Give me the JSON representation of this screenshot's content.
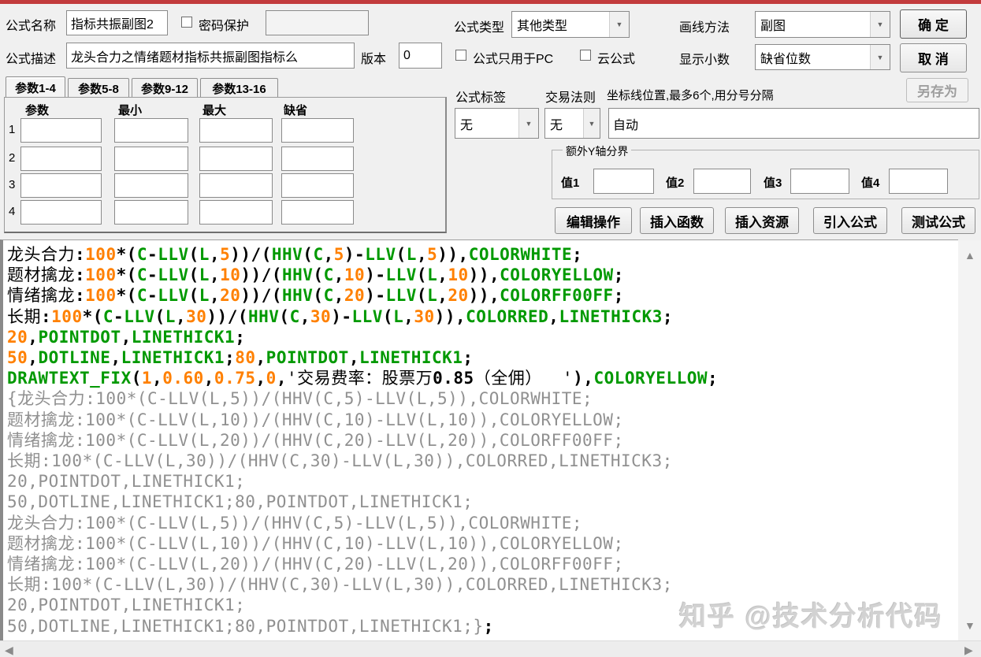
{
  "window": {
    "top_edge_color": "#c23b3d"
  },
  "icons": {
    "combo_arrow": "▼",
    "scroll_up": "▲",
    "scroll_down": "▼",
    "scroll_left": "◀",
    "scroll_right": "▶"
  },
  "form": {
    "name_label": "公式名称",
    "name_value": "指标共振副图2",
    "password_label": "密码保护",
    "password_value": "",
    "desc_label": "公式描述",
    "desc_value": "龙头合力之情绪题材指标共振副图指标么",
    "version_label": "版本",
    "version_value": "0",
    "type_label": "公式类型",
    "type_value": "其他类型",
    "draw_method_label": "画线方法",
    "draw_method_value": "副图",
    "pc_only_label": "公式只用于PC",
    "cloud_label": "云公式",
    "decimals_label": "显示小数",
    "decimals_value": "缺省位数",
    "ok_label": "确 定",
    "cancel_label": "取 消",
    "save_as_label": "另存为"
  },
  "params": {
    "tabs": [
      "参数1-4",
      "参数5-8",
      "参数9-12",
      "参数13-16"
    ],
    "active_tab": "参数1-4",
    "columns": [
      "参数",
      "最小",
      "最大",
      "缺省"
    ],
    "row_labels": [
      "1",
      "2",
      "3",
      "4"
    ],
    "cell_values": [
      [
        "",
        "",
        "",
        ""
      ],
      [
        "",
        "",
        "",
        ""
      ],
      [
        "",
        "",
        "",
        ""
      ],
      [
        "",
        "",
        "",
        ""
      ]
    ]
  },
  "formula_meta": {
    "tag_label": "公式标签",
    "tag_value": "无",
    "rule_label": "交易法则",
    "rule_value": "无",
    "gridline_label": "坐标线位置,最多6个,用分号分隔",
    "gridline_value": "自动",
    "y_axis_group_label": "额外Y轴分界",
    "y_axis_fields": [
      {
        "label": "值1",
        "value": ""
      },
      {
        "label": "值2",
        "value": ""
      },
      {
        "label": "值3",
        "value": ""
      },
      {
        "label": "值4",
        "value": ""
      }
    ],
    "action_buttons": [
      "编辑操作",
      "插入函数",
      "插入资源",
      "引入公式",
      "测试公式"
    ]
  },
  "code": {
    "colors": {
      "identifier": "#000000",
      "number": "#ff8000",
      "keyword": "#009900",
      "comment": "#909090",
      "string": "#000000"
    },
    "lines": [
      [
        [
          "id",
          "龙头合力"
        ],
        [
          "p",
          ":"
        ],
        [
          "n",
          "100"
        ],
        [
          "p",
          "*("
        ],
        [
          "f",
          "C"
        ],
        [
          "p",
          "-"
        ],
        [
          "f",
          "LLV"
        ],
        [
          "p",
          "("
        ],
        [
          "f",
          "L"
        ],
        [
          "p",
          ","
        ],
        [
          "n",
          "5"
        ],
        [
          "p",
          "))/("
        ],
        [
          "f",
          "HHV"
        ],
        [
          "p",
          "("
        ],
        [
          "f",
          "C"
        ],
        [
          "p",
          ","
        ],
        [
          "n",
          "5"
        ],
        [
          "p",
          ")-"
        ],
        [
          "f",
          "LLV"
        ],
        [
          "p",
          "("
        ],
        [
          "f",
          "L"
        ],
        [
          "p",
          ","
        ],
        [
          "n",
          "5"
        ],
        [
          "p",
          ")),"
        ],
        [
          "f",
          "COLORWHITE"
        ],
        [
          "p",
          ";"
        ]
      ],
      [
        [
          "id",
          "题材擒龙"
        ],
        [
          "p",
          ":"
        ],
        [
          "n",
          "100"
        ],
        [
          "p",
          "*("
        ],
        [
          "f",
          "C"
        ],
        [
          "p",
          "-"
        ],
        [
          "f",
          "LLV"
        ],
        [
          "p",
          "("
        ],
        [
          "f",
          "L"
        ],
        [
          "p",
          ","
        ],
        [
          "n",
          "10"
        ],
        [
          "p",
          "))/("
        ],
        [
          "f",
          "HHV"
        ],
        [
          "p",
          "("
        ],
        [
          "f",
          "C"
        ],
        [
          "p",
          ","
        ],
        [
          "n",
          "10"
        ],
        [
          "p",
          ")-"
        ],
        [
          "f",
          "LLV"
        ],
        [
          "p",
          "("
        ],
        [
          "f",
          "L"
        ],
        [
          "p",
          ","
        ],
        [
          "n",
          "10"
        ],
        [
          "p",
          ")),"
        ],
        [
          "f",
          "COLORYELLOW"
        ],
        [
          "p",
          ";"
        ]
      ],
      [
        [
          "id",
          "情绪擒龙"
        ],
        [
          "p",
          ":"
        ],
        [
          "n",
          "100"
        ],
        [
          "p",
          "*("
        ],
        [
          "f",
          "C"
        ],
        [
          "p",
          "-"
        ],
        [
          "f",
          "LLV"
        ],
        [
          "p",
          "("
        ],
        [
          "f",
          "L"
        ],
        [
          "p",
          ","
        ],
        [
          "n",
          "20"
        ],
        [
          "p",
          "))/("
        ],
        [
          "f",
          "HHV"
        ],
        [
          "p",
          "("
        ],
        [
          "f",
          "C"
        ],
        [
          "p",
          ","
        ],
        [
          "n",
          "20"
        ],
        [
          "p",
          ")-"
        ],
        [
          "f",
          "LLV"
        ],
        [
          "p",
          "("
        ],
        [
          "f",
          "L"
        ],
        [
          "p",
          ","
        ],
        [
          "n",
          "20"
        ],
        [
          "p",
          ")),"
        ],
        [
          "f",
          "COLORFF00FF"
        ],
        [
          "p",
          ";"
        ]
      ],
      [
        [
          "id",
          "长期"
        ],
        [
          "p",
          ":"
        ],
        [
          "n",
          "100"
        ],
        [
          "p",
          "*("
        ],
        [
          "f",
          "C"
        ],
        [
          "p",
          "-"
        ],
        [
          "f",
          "LLV"
        ],
        [
          "p",
          "("
        ],
        [
          "f",
          "L"
        ],
        [
          "p",
          ","
        ],
        [
          "n",
          "30"
        ],
        [
          "p",
          "))/("
        ],
        [
          "f",
          "HHV"
        ],
        [
          "p",
          "("
        ],
        [
          "f",
          "C"
        ],
        [
          "p",
          ","
        ],
        [
          "n",
          "30"
        ],
        [
          "p",
          ")-"
        ],
        [
          "f",
          "LLV"
        ],
        [
          "p",
          "("
        ],
        [
          "f",
          "L"
        ],
        [
          "p",
          ","
        ],
        [
          "n",
          "30"
        ],
        [
          "p",
          ")),"
        ],
        [
          "f",
          "COLORRED"
        ],
        [
          "p",
          ","
        ],
        [
          "f",
          "LINETHICK3"
        ],
        [
          "p",
          ";"
        ]
      ],
      [
        [
          "n",
          "20"
        ],
        [
          "p",
          ","
        ],
        [
          "f",
          "POINTDOT"
        ],
        [
          "p",
          ","
        ],
        [
          "f",
          "LINETHICK1"
        ],
        [
          "p",
          ";"
        ]
      ],
      [
        [
          "n",
          "50"
        ],
        [
          "p",
          ","
        ],
        [
          "f",
          "DOTLINE"
        ],
        [
          "p",
          ","
        ],
        [
          "f",
          "LINETHICK1"
        ],
        [
          "p",
          ";"
        ],
        [
          "n",
          "80"
        ],
        [
          "p",
          ","
        ],
        [
          "f",
          "POINTDOT"
        ],
        [
          "p",
          ","
        ],
        [
          "f",
          "LINETHICK1"
        ],
        [
          "p",
          ";"
        ]
      ],
      [
        [
          "f",
          "DRAWTEXT_FIX"
        ],
        [
          "p",
          "("
        ],
        [
          "n",
          "1"
        ],
        [
          "p",
          ","
        ],
        [
          "n",
          "0.60"
        ],
        [
          "p",
          ","
        ],
        [
          "n",
          "0.75"
        ],
        [
          "p",
          ","
        ],
        [
          "n",
          "0"
        ],
        [
          "p",
          ","
        ],
        [
          "s",
          "'交易费率：股票万"
        ],
        [
          "pb",
          "0.85"
        ],
        [
          "s",
          "（全佣）  '"
        ],
        [
          "p",
          "),"
        ],
        [
          "f",
          "COLORYELLOW"
        ],
        [
          "p",
          ";"
        ]
      ],
      [
        [
          "c",
          "{龙头合力:100*(C-LLV(L,5))/(HHV(C,5)-LLV(L,5)),COLORWHITE;"
        ]
      ],
      [
        [
          "c",
          "题材擒龙:100*(C-LLV(L,10))/(HHV(C,10)-LLV(L,10)),COLORYELLOW;"
        ]
      ],
      [
        [
          "c",
          "情绪擒龙:100*(C-LLV(L,20))/(HHV(C,20)-LLV(L,20)),COLORFF00FF;"
        ]
      ],
      [
        [
          "c",
          "长期:100*(C-LLV(L,30))/(HHV(C,30)-LLV(L,30)),COLORRED,LINETHICK3;"
        ]
      ],
      [
        [
          "c",
          "20,POINTDOT,LINETHICK1;"
        ]
      ],
      [
        [
          "c",
          "50,DOTLINE,LINETHICK1;80,POINTDOT,LINETHICK1;"
        ]
      ],
      [
        [
          "c",
          "龙头合力:100*(C-LLV(L,5))/(HHV(C,5)-LLV(L,5)),COLORWHITE;"
        ]
      ],
      [
        [
          "c",
          "题材擒龙:100*(C-LLV(L,10))/(HHV(C,10)-LLV(L,10)),COLORYELLOW;"
        ]
      ],
      [
        [
          "c",
          "情绪擒龙:100*(C-LLV(L,20))/(HHV(C,20)-LLV(L,20)),COLORFF00FF;"
        ]
      ],
      [
        [
          "c",
          "长期:100*(C-LLV(L,30))/(HHV(C,30)-LLV(L,30)),COLORRED,LINETHICK3;"
        ]
      ],
      [
        [
          "c",
          "20,POINTDOT,LINETHICK1;"
        ]
      ],
      [
        [
          "c",
          "50,DOTLINE,LINETHICK1;80,POINTDOT,LINETHICK1;}"
        ],
        [
          "pb",
          ";"
        ]
      ]
    ]
  },
  "watermark": "知乎 @技术分析代码"
}
